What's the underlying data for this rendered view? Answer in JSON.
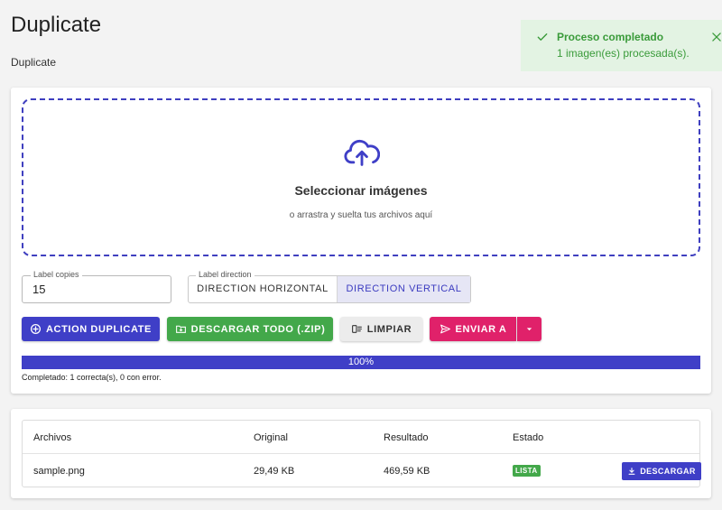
{
  "page": {
    "title": "Duplicate",
    "subtitle": "Duplicate"
  },
  "toast": {
    "title": "Proceso completado",
    "message": "1 imagen(es) procesada(s).",
    "icon": "check-icon",
    "color": "#3a9b3a"
  },
  "dropzone": {
    "icon": "cloud-upload-icon",
    "title": "Seleccionar imágenes",
    "hint": "o arrastra y suelta tus archivos aquí"
  },
  "copies": {
    "label": "Label copies",
    "value": "15"
  },
  "direction": {
    "label": "Label direction",
    "options": [
      "DIRECTION HORIZONTAL",
      "DIRECTION VERTICAL"
    ],
    "selected": "DIRECTION VERTICAL"
  },
  "actions": {
    "duplicate": "ACTION DUPLICATE",
    "download_zip": "DESCARGAR TODO (.ZIP)",
    "clear": "LIMPIAR",
    "send_to": "ENVIAR A"
  },
  "progress": {
    "value": 100,
    "label": "100%",
    "status": "Completado: 1 correcta(s), 0 con error."
  },
  "table": {
    "headers": [
      "Archivos",
      "Original",
      "Resultado",
      "Estado"
    ],
    "rows": [
      {
        "file": "sample.png",
        "original": "29,49 KB",
        "result": "469,59 KB",
        "status": "LISTA",
        "action": "DESCARGAR"
      }
    ]
  },
  "colors": {
    "primary": "#3f3fc7",
    "success": "#43a84a",
    "accent": "#e0216a"
  }
}
